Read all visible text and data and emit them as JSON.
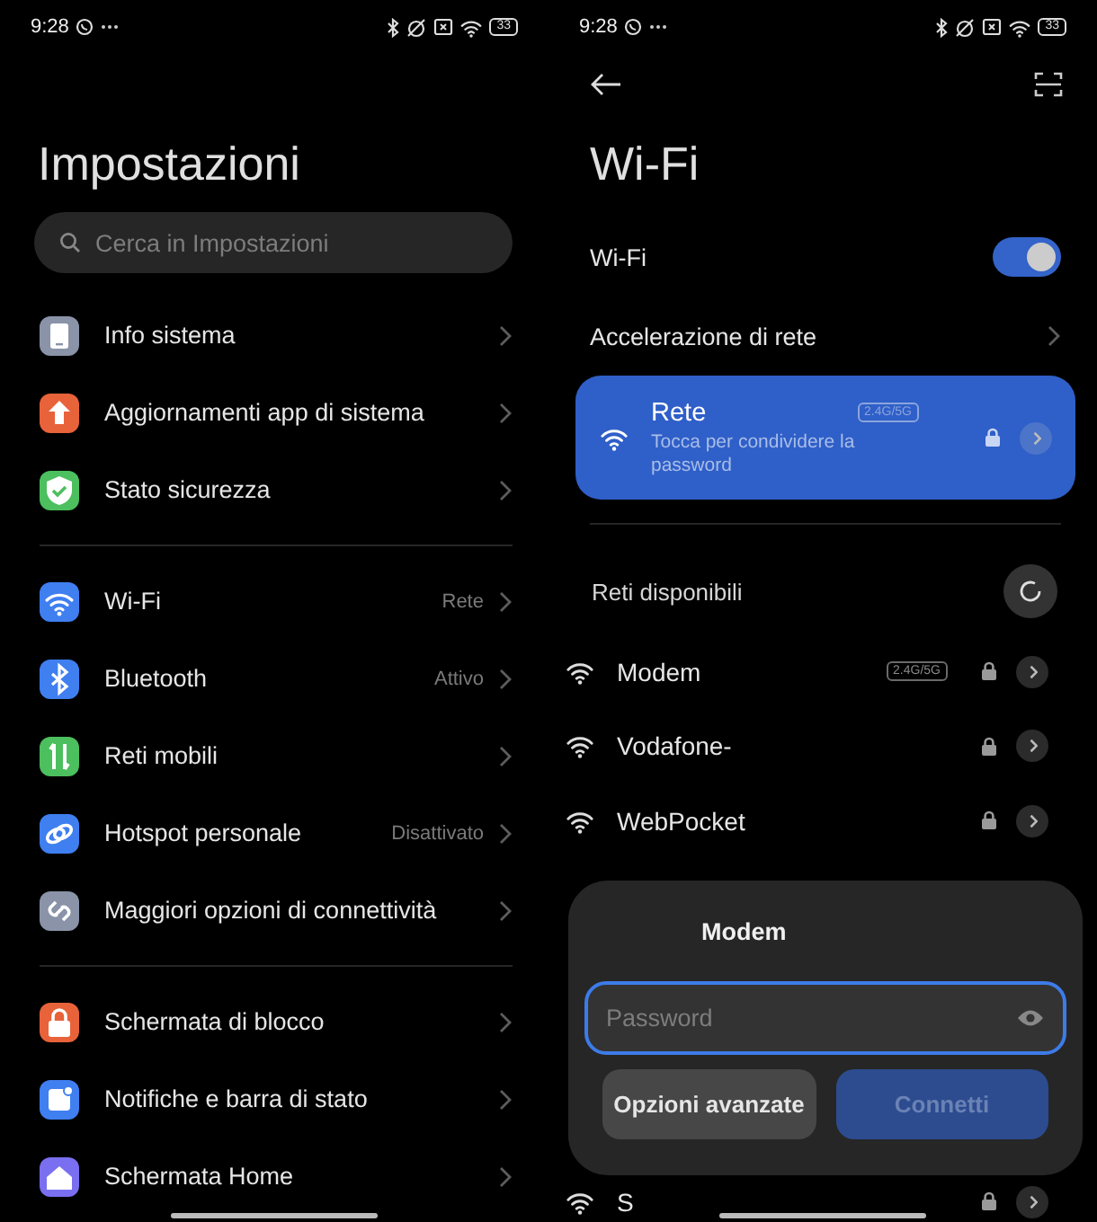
{
  "status_bars": [
    {
      "time": "9:28",
      "battery": "33"
    },
    {
      "time": "9:28",
      "battery": "33"
    }
  ],
  "settings_screen": {
    "title": "Impostazioni",
    "search": {
      "placeholder": "Cerca in Impostazioni"
    },
    "groups": [
      {
        "items": [
          {
            "label": "Info sistema",
            "color": "#8a93a8"
          },
          {
            "label": "Aggiornamenti app di sistema",
            "color": "#e8623a"
          },
          {
            "label": "Stato sicurezza",
            "color": "#4cbf5e"
          }
        ]
      },
      {
        "items": [
          {
            "label": "Wi-Fi",
            "value": "Rete",
            "color": "#3f7ff0"
          },
          {
            "label": "Bluetooth",
            "value": "Attivo",
            "color": "#3f7ff0"
          },
          {
            "label": "Reti mobili",
            "color": "#4cbf5e"
          },
          {
            "label": "Hotspot personale",
            "value": "Disattivato",
            "color": "#3f7ff0"
          },
          {
            "label": "Maggiori opzioni di connettività",
            "color": "#8a93a8"
          }
        ]
      },
      {
        "items": [
          {
            "label": "Schermata di blocco",
            "color": "#e8623a"
          },
          {
            "label": "Notifiche e barra di stato",
            "color": "#3f7ff0"
          },
          {
            "label": "Schermata Home",
            "color": "#7a6ff0"
          }
        ]
      }
    ]
  },
  "wifi_screen": {
    "title": "Wi-Fi",
    "wifi_toggle": {
      "label": "Wi-Fi",
      "on": true
    },
    "acceleration": {
      "label": "Accelerazione di rete"
    },
    "connected_network": {
      "name": "Rete",
      "band": "2.4G/5G",
      "subtitle": "Tocca per condividere la password",
      "locked": true
    },
    "available_title": "Reti disponibili",
    "networks": [
      {
        "name": "Modem",
        "band": "2.4G/5G",
        "locked": true
      },
      {
        "name": "Vodafone-",
        "locked": true
      },
      {
        "name": "WebPocket",
        "locked": true
      },
      {
        "name": "S",
        "locked": true
      }
    ],
    "dialog": {
      "title": "Modem",
      "password": {
        "placeholder": "Password",
        "focused": true
      },
      "buttons": [
        {
          "label": "Opzioni avanzate",
          "kind": "secondary",
          "disabled": false
        },
        {
          "label": "Connetti",
          "kind": "primary",
          "disabled": true
        }
      ]
    }
  }
}
